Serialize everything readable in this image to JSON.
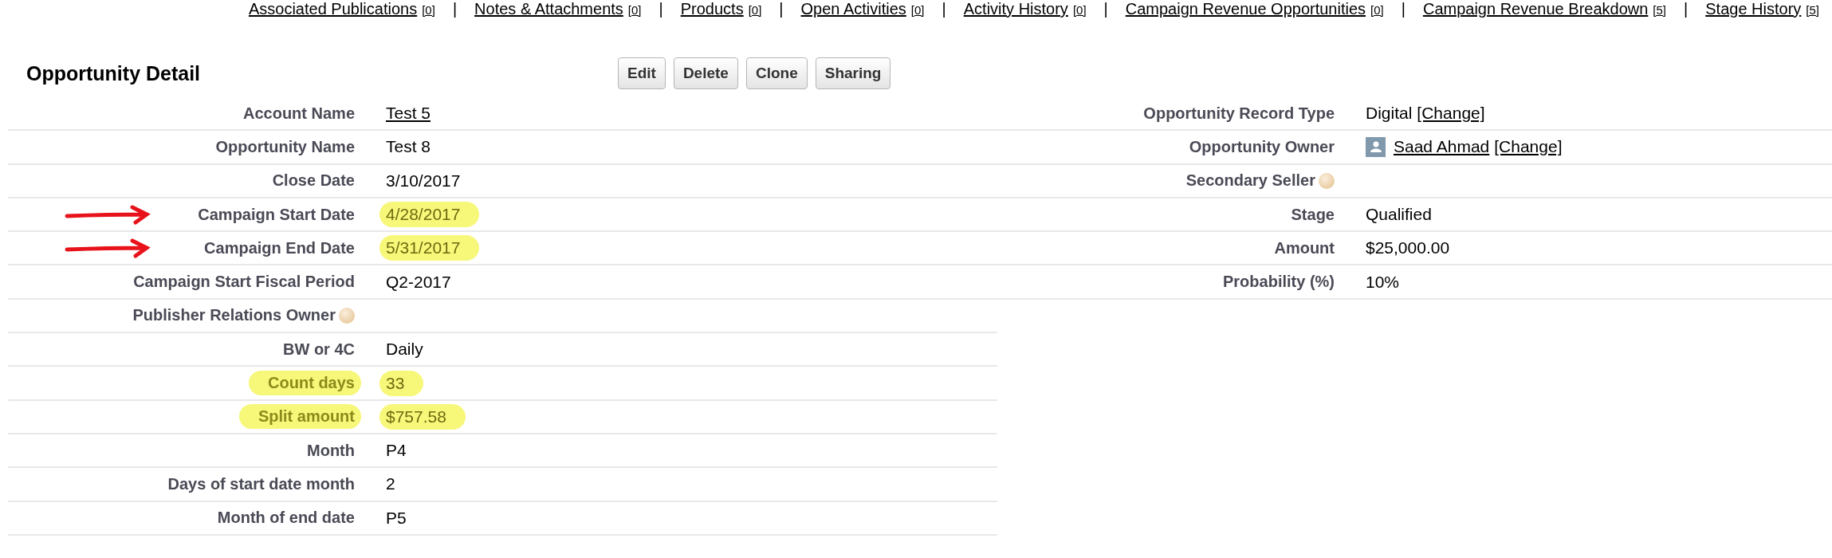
{
  "related_links": [
    {
      "label": "Associated Publications",
      "count": "[0]"
    },
    {
      "label": "Notes & Attachments",
      "count": "[0]"
    },
    {
      "label": "Products",
      "count": "[0]"
    },
    {
      "label": "Open Activities",
      "count": "[0]"
    },
    {
      "label": "Activity History",
      "count": "[0]"
    },
    {
      "label": "Campaign Revenue Opportunities",
      "count": "[0]"
    },
    {
      "label": "Campaign Revenue Breakdown",
      "count": "[5]"
    },
    {
      "label": "Stage History",
      "count": "[5]"
    }
  ],
  "link_separator": "|",
  "section": {
    "title": "Opportunity Detail",
    "buttons": [
      "Edit",
      "Delete",
      "Clone",
      "Sharing"
    ]
  },
  "left_fields": [
    {
      "label": "Account Name",
      "value": [
        {
          "text": "Test 5",
          "link": true
        }
      ]
    },
    {
      "label": "Opportunity Name",
      "value": [
        {
          "text": "Test 8",
          "link": false
        }
      ]
    },
    {
      "label": "Close Date",
      "value": [
        {
          "text": "3/10/2017",
          "link": false
        }
      ]
    },
    {
      "label": "Campaign Start Date",
      "value": [
        {
          "text": "4/28/2017",
          "link": false
        }
      ],
      "arrow": true,
      "value_highlighted": true
    },
    {
      "label": "Campaign End Date",
      "value": [
        {
          "text": "5/31/2017",
          "link": false
        }
      ],
      "arrow": true,
      "value_highlighted": true
    },
    {
      "label": "Campaign Start Fiscal Period",
      "value": [
        {
          "text": "Q2-2017",
          "link": false
        }
      ]
    },
    {
      "label": "Publisher Relations Owner",
      "help": true
    },
    {
      "label": "BW or 4C",
      "value": [
        {
          "text": "Daily",
          "link": false
        }
      ]
    },
    {
      "label": "Count days",
      "value": [
        {
          "text": "33",
          "link": false
        }
      ],
      "label_highlighted": true,
      "value_highlighted": true
    },
    {
      "label": "Split amount",
      "value": [
        {
          "text": "$757.58",
          "link": false
        }
      ],
      "label_highlighted": true,
      "value_highlighted": true
    },
    {
      "label": "Month",
      "value": [
        {
          "text": "P4",
          "link": false
        }
      ]
    },
    {
      "label": "Days of start date month",
      "value": [
        {
          "text": "2",
          "link": false
        }
      ]
    },
    {
      "label": "Month of end date",
      "value": [
        {
          "text": "P5",
          "link": false
        }
      ]
    }
  ],
  "right_fields": [
    {
      "label": "Opportunity Record Type",
      "value": [
        {
          "text": "Digital",
          "link": false
        },
        {
          "text": "[Change]",
          "link": true
        }
      ]
    },
    {
      "label": "Opportunity Owner",
      "avatar": true,
      "value": [
        {
          "text": "Saad Ahmad",
          "link": true
        },
        {
          "text": "[Change]",
          "link": true
        }
      ]
    },
    {
      "label": "Secondary Seller",
      "help": true
    },
    {
      "label": "Stage",
      "value": [
        {
          "text": "Qualified",
          "link": false
        }
      ]
    },
    {
      "label": "Amount",
      "value": [
        {
          "text": "$25,000.00",
          "link": false
        }
      ]
    },
    {
      "label": "Probability (%)",
      "value": [
        {
          "text": "10%",
          "link": false
        }
      ]
    }
  ]
}
